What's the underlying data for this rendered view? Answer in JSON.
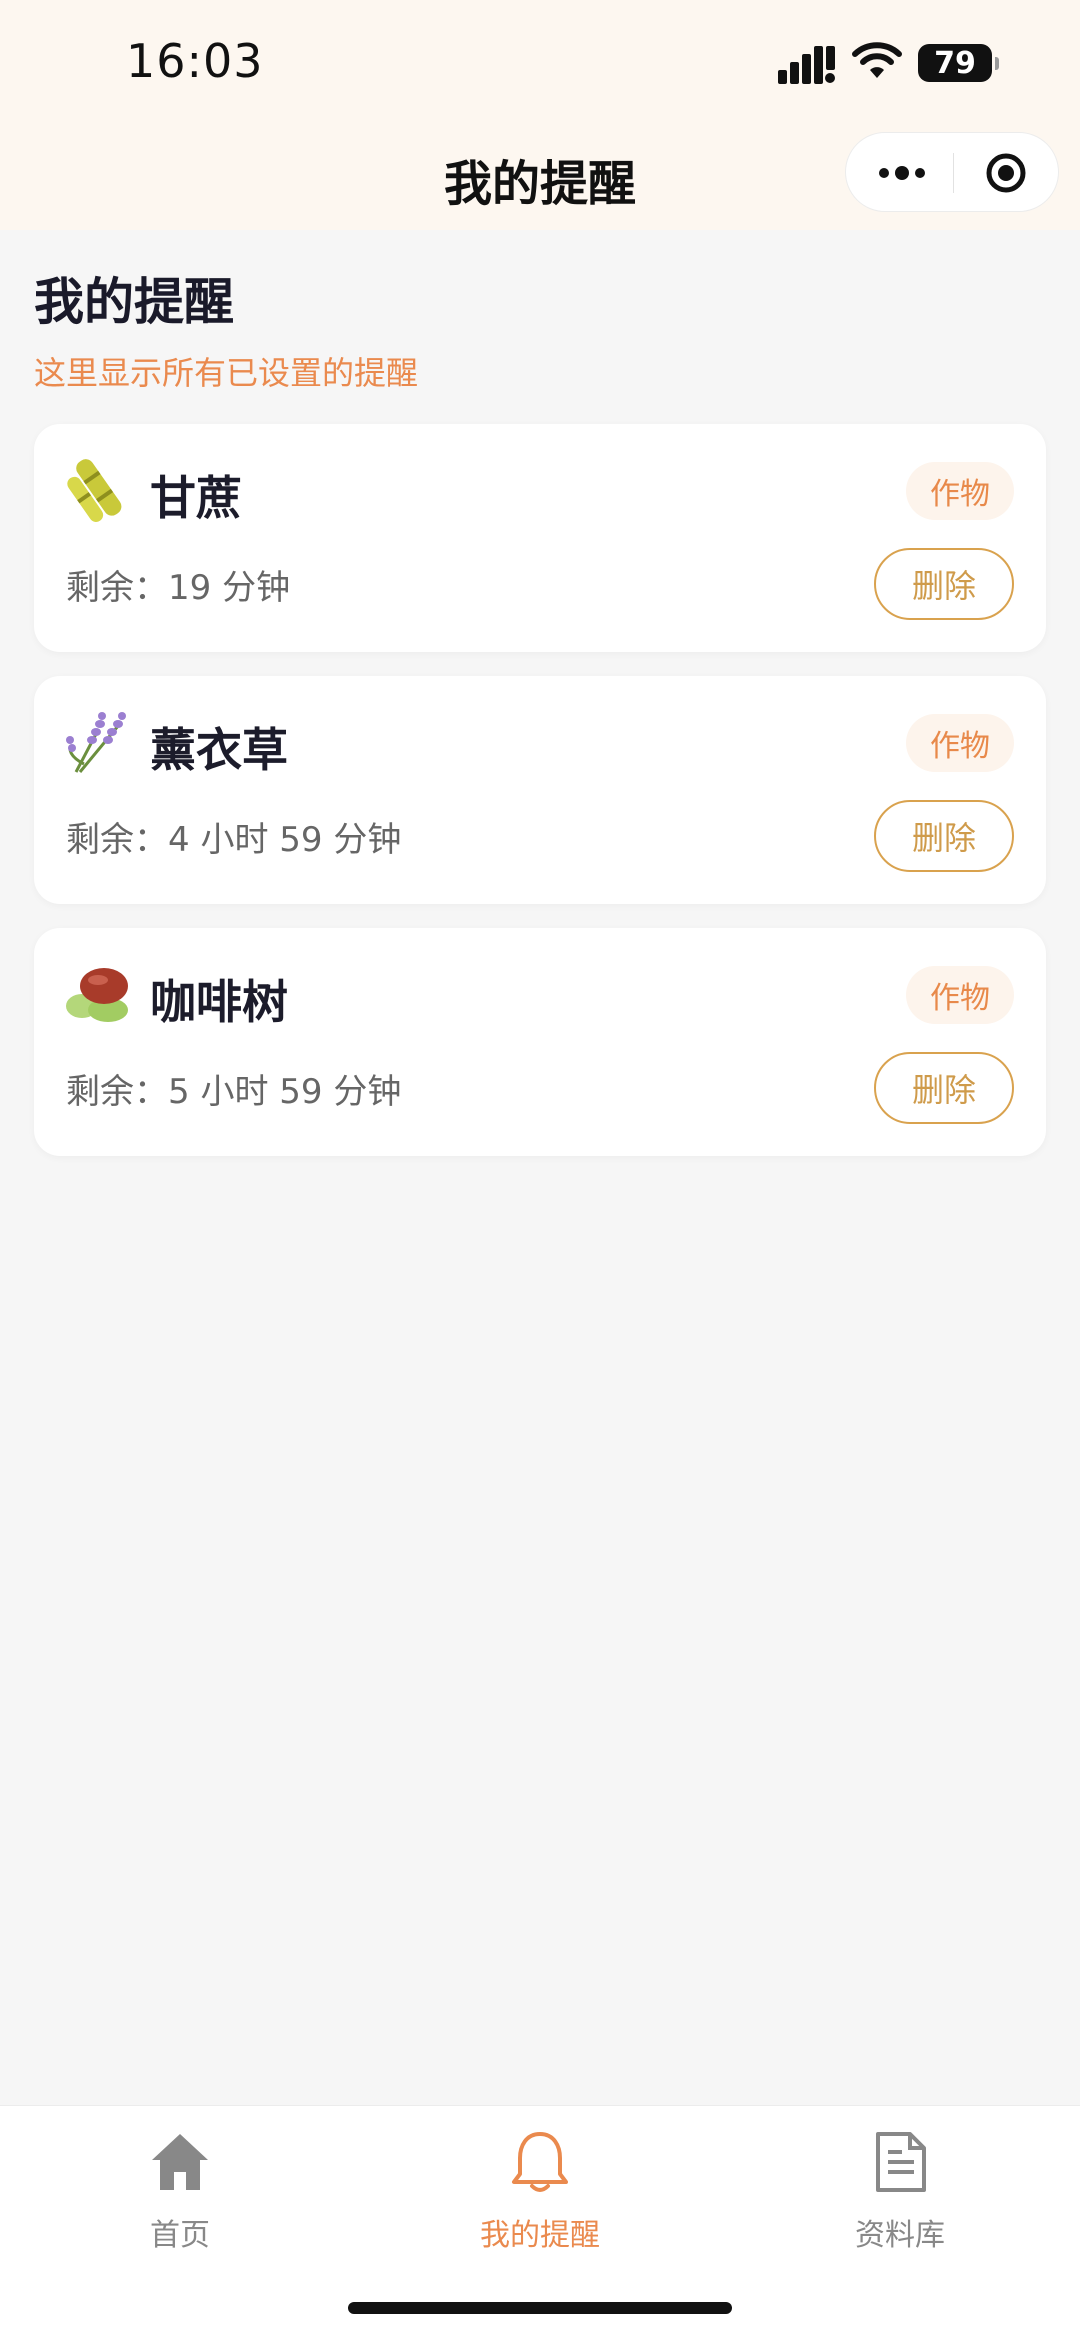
{
  "status_bar": {
    "time": "16:03",
    "battery": "79",
    "signal_icon": "signal-icon",
    "wifi_icon": "wifi-icon"
  },
  "nav_bar": {
    "title": "我的提醒",
    "more_icon": "more-icon",
    "close_icon": "target-icon"
  },
  "header": {
    "title": "我的提醒",
    "subtitle": "这里显示所有已设置的提醒"
  },
  "reminders": [
    {
      "icon": "sugarcane-icon",
      "name": "甘蔗",
      "tag": "作物",
      "remaining": "剩余：19 分钟",
      "delete_label": "删除"
    },
    {
      "icon": "lavender-icon",
      "name": "薰衣草",
      "tag": "作物",
      "remaining": "剩余：4 小时 59 分钟",
      "delete_label": "删除"
    },
    {
      "icon": "coffee-tree-icon",
      "name": "咖啡树",
      "tag": "作物",
      "remaining": "剩余：5 小时 59 分钟",
      "delete_label": "删除"
    }
  ],
  "tab_bar": {
    "tabs": [
      {
        "label": "首页",
        "icon": "home-icon"
      },
      {
        "label": "我的提醒",
        "icon": "bell-icon",
        "active": true
      },
      {
        "label": "资料库",
        "icon": "document-icon"
      }
    ]
  },
  "colors": {
    "accent": "#ea8a4e",
    "delete_border": "#d9a24e",
    "header_bg": "#fdf7f0",
    "page_bg": "#f6f6f6"
  }
}
